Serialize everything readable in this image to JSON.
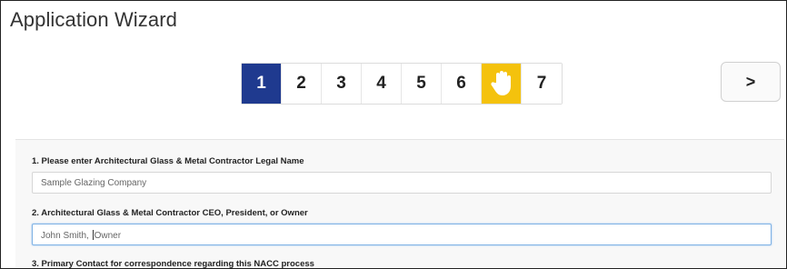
{
  "window": {
    "title": "Application Wizard"
  },
  "stepper": {
    "steps": [
      {
        "label": "1",
        "state": "active"
      },
      {
        "label": "2",
        "state": "default"
      },
      {
        "label": "3",
        "state": "default"
      },
      {
        "label": "4",
        "state": "default"
      },
      {
        "label": "5",
        "state": "default"
      },
      {
        "label": "6",
        "state": "default"
      },
      {
        "label": "",
        "state": "warning",
        "icon": "hand-stop-icon"
      },
      {
        "label": "7",
        "state": "default"
      }
    ],
    "next_icon": "chevron-right-icon",
    "next_label": ">"
  },
  "form": {
    "q1": {
      "label": "1. Please enter Architectural Glass & Metal Contractor Legal Name",
      "value": "Sample Glazing Company"
    },
    "q2": {
      "label": "2. Architectural Glass & Metal Contractor CEO, President, or Owner",
      "value_before_caret": "John Smith, ",
      "value_after_caret": "Owner"
    },
    "q3": {
      "label": "3. Primary Contact for correspondence regarding this NACC process"
    }
  },
  "colors": {
    "active_step": "#1f3a8f",
    "warning_step": "#f4c20d",
    "focus_border": "#7fb2e5"
  }
}
